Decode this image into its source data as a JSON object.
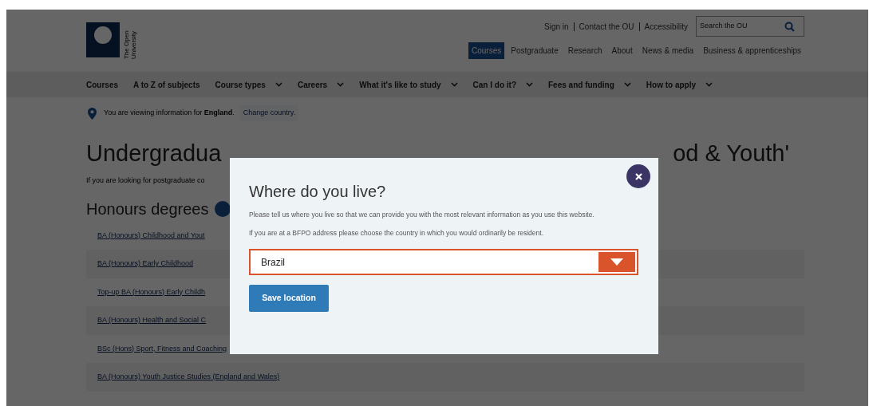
{
  "header": {
    "logo_text": "The Open University",
    "top_links": [
      "Sign in",
      "Contact the OU",
      "Accessibility"
    ],
    "search": {
      "placeholder": "Search the OU"
    },
    "site_tabs": [
      {
        "label": "Courses",
        "selected": true
      },
      {
        "label": "Postgraduate",
        "selected": false
      },
      {
        "label": "Research",
        "selected": false
      },
      {
        "label": "About",
        "selected": false
      },
      {
        "label": "News & media",
        "selected": false
      },
      {
        "label": "Business & apprenticeships",
        "selected": false
      }
    ]
  },
  "nav": [
    {
      "label": "Courses",
      "has_menu": false
    },
    {
      "label": "A to Z of subjects",
      "has_menu": false
    },
    {
      "label": "Course types",
      "has_menu": true
    },
    {
      "label": "Careers",
      "has_menu": true
    },
    {
      "label": "What it's like to study",
      "has_menu": true
    },
    {
      "label": "Can I do it?",
      "has_menu": true
    },
    {
      "label": "Fees and funding",
      "has_menu": true
    },
    {
      "label": "How to apply",
      "has_menu": true
    }
  ],
  "location": {
    "text": "You are viewing information for **England**.",
    "link": "Change country."
  },
  "content": {
    "heading_parts": [
      "Undergradua",
      "od & Youth'"
    ],
    "intro": "If you are looking for postgraduate co",
    "section_title": "Honours degrees",
    "courses": [
      "BA (Honours) Childhood and Yout",
      "BA (Honours) Early Childhood",
      "Top-up BA (Honours) Early Childh",
      "BA (Honours) Health and Social C",
      "BSc (Hons) Sport, Fitness and Coaching",
      "BA (Honours) Youth Justice Studies (England and Wales)"
    ]
  },
  "modal": {
    "title": "Where do you live?",
    "paragraphs": [
      "Please tell us where you live so that we can provide you with the most relevant information as you use this website.",
      "If you are at a BFPO address please choose the country in which you would ordinarily be resident."
    ],
    "select": {
      "value": "Brazil",
      "focused": true
    },
    "button": "Save location"
  }
}
